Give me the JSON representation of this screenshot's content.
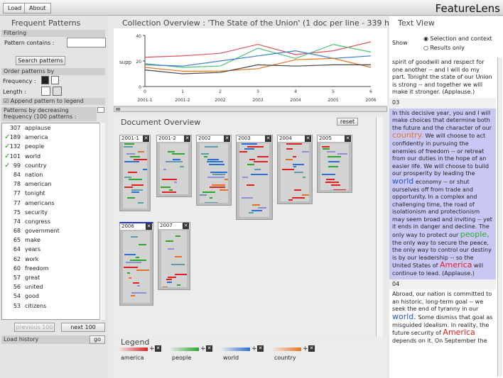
{
  "topbar": {
    "load": "Load",
    "about": "About",
    "title": "FeatureLens"
  },
  "left": {
    "title": "Frequent Patterns",
    "filtering": "Filtering",
    "pattern_contains": "Pattern contains :",
    "search_button": "Search patterns",
    "order_by": "Order patterns by",
    "frequency": "Frequency :",
    "length": "Length :",
    "append": "Append pattern to legend",
    "list_header": "Patterns by decreasing frequency (100 patterns :",
    "patterns": [
      {
        "count": "307",
        "label": "applause",
        "checked": false
      },
      {
        "count": "189",
        "label": "america",
        "checked": true
      },
      {
        "count": "132",
        "label": "people",
        "checked": true
      },
      {
        "count": "101",
        "label": "world",
        "checked": true
      },
      {
        "count": "99",
        "label": "country",
        "checked": true
      },
      {
        "count": "84",
        "label": "nation",
        "checked": false
      },
      {
        "count": "78",
        "label": "american",
        "checked": false
      },
      {
        "count": "77",
        "label": "tonight",
        "checked": false
      },
      {
        "count": "77",
        "label": "americans",
        "checked": false
      },
      {
        "count": "75",
        "label": "security",
        "checked": false
      },
      {
        "count": "74",
        "label": "congress",
        "checked": false
      },
      {
        "count": "68",
        "label": "government",
        "checked": false
      },
      {
        "count": "65",
        "label": "make",
        "checked": false
      },
      {
        "count": "64",
        "label": "years",
        "checked": false
      },
      {
        "count": "62",
        "label": "work",
        "checked": false
      },
      {
        "count": "60",
        "label": "freedom",
        "checked": false
      },
      {
        "count": "57",
        "label": "great",
        "checked": false
      },
      {
        "count": "56",
        "label": "united",
        "checked": false
      },
      {
        "count": "54",
        "label": "good",
        "checked": false
      },
      {
        "count": "53",
        "label": "citizens",
        "checked": false
      }
    ],
    "previous": "previous 100",
    "next": "next 100",
    "load_history": "Load history",
    "go": "go"
  },
  "collection": {
    "title": "Collection Overview : 'The State of the Union' (1 doc per line - 339 highli",
    "ylabel": "supp",
    "doc_labels": [
      "2001-1",
      "2001-2",
      "2002",
      "2003",
      "2004",
      "2005",
      "2006"
    ]
  },
  "chart_data": {
    "type": "line",
    "x": [
      0,
      1,
      2,
      3,
      4,
      5,
      6
    ],
    "ylim": [
      0,
      40
    ],
    "xlim": [
      0,
      6
    ],
    "colors": {
      "america": "#e0505a",
      "people": "#4cbf72",
      "world": "#3a7fd0",
      "country": "#e8731e",
      "other": "#444444"
    },
    "series": [
      {
        "name": "america",
        "values": [
          23,
          24,
          26,
          33,
          25,
          28,
          35
        ]
      },
      {
        "name": "people",
        "values": [
          18,
          15,
          16,
          30,
          22,
          33,
          27
        ]
      },
      {
        "name": "world",
        "values": [
          17,
          16,
          20,
          24,
          28,
          22,
          24
        ]
      },
      {
        "name": "country",
        "values": [
          15,
          12,
          12,
          14,
          21,
          22,
          15
        ]
      },
      {
        "name": "other",
        "values": [
          13,
          10,
          11,
          17,
          16,
          17,
          17
        ]
      }
    ],
    "yticks": [
      0,
      20,
      40
    ],
    "xticks": [
      "0",
      "1",
      "2",
      "3",
      "4",
      "5",
      "6"
    ]
  },
  "docov": {
    "title": "Document Overview",
    "reset": "reset",
    "docs": [
      "2001-1",
      "2001-2",
      "2002",
      "2003",
      "2004",
      "2005",
      "2006",
      "2007"
    ]
  },
  "legend": {
    "title": "Legend",
    "items": [
      {
        "label": "america",
        "color": "#e02020"
      },
      {
        "label": "people",
        "color": "#2aa82a"
      },
      {
        "label": "world",
        "color": "#2a6fd6"
      },
      {
        "label": "country",
        "color": "#e8731e"
      }
    ]
  },
  "textview": {
    "title": "Text View",
    "show": "Show",
    "opt1": "Selection and context",
    "opt2": "Results only",
    "p1": "spirit of goodwill and respect for one another -- and I will do my part. Tonight the state of our Union is strong -- and together we will make it stronger. (Applause.)",
    "n1": "03",
    "p2a": "In this decisive year, you and I will make choices that determine both the future and the character of our",
    "w_country": "country.",
    "p2b": "We will choose to act confidently in pursuing the enemies of freedom -- or retreat from our duties in the hope of an easier life. We will choose to build our prosperity by leading the",
    "w_world": "world",
    "p2c": "economy -- or shut ourselves off from trade and opportunity. In a complex and challenging time, the road of isolationism and protectionism may seem broad and inviting -- yet it ends in danger and decline. The only way to protect our",
    "w_people": "people,",
    "p2d": "the only way to secure the peace, the only way to control our destiny is by our leadership -- so the United States of",
    "w_america": "America",
    "p2e": "will continue to lead. (Applause.)",
    "n2": "04",
    "p3a": "Abroad, our nation is committed to an historic, long-term goal -- we seek the end of tyranny in our",
    "w_world2": "world.",
    "p3b": "Some dismiss that goal as misguided idealism. In reality, the future security of",
    "w_america2": "America",
    "p3c": "depends on it. On September the"
  }
}
